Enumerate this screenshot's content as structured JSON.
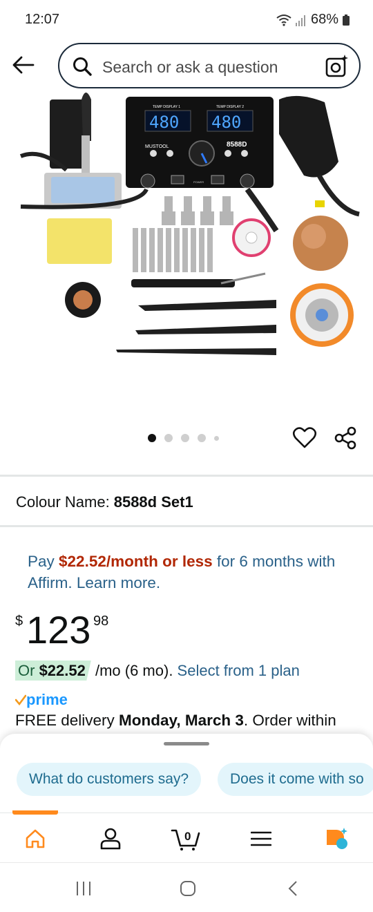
{
  "status_bar": {
    "time": "12:07",
    "battery": "68%"
  },
  "search": {
    "placeholder": "Search or ask a question"
  },
  "product_image": {
    "brand": "MUSTOOL",
    "model": "8588D",
    "display_left_label": "TEMP DISPLAY 1",
    "display_right_label": "TEMP DISPLAY 2",
    "display_left_value": "480",
    "display_right_value": "480",
    "power_label": "POWER"
  },
  "carousel": {
    "count": 5,
    "active_index": 0
  },
  "colour": {
    "label": "Colour Name:",
    "value": "8588d Set1"
  },
  "affirm": {
    "prefix": "Pay ",
    "amount": "$22.52/month or less",
    "suffix": " for 6 months with Affirm. Learn more."
  },
  "price": {
    "symbol": "$",
    "whole": "123",
    "fraction": "98"
  },
  "installment": {
    "or_text": "Or ",
    "amount": "$22.52",
    "term": " /mo (6 mo). ",
    "link": "Select from 1 plan"
  },
  "prime": {
    "label": "prime"
  },
  "delivery": {
    "prefix": "FREE delivery ",
    "date": "Monday, March 3",
    "suffix": ". Order within"
  },
  "chips": [
    "What do customers say?",
    "Does it come with so"
  ],
  "bottom_nav": {
    "cart_count": "0",
    "items": [
      "home-icon",
      "profile-icon",
      "cart-icon",
      "menu-icon",
      "rufus-ai-icon"
    ]
  },
  "colors": {
    "amazon_orange": "#ff8a1d",
    "link_blue": "#2a6189",
    "price_red": "#b12704",
    "prime_blue": "#1a98ff"
  }
}
